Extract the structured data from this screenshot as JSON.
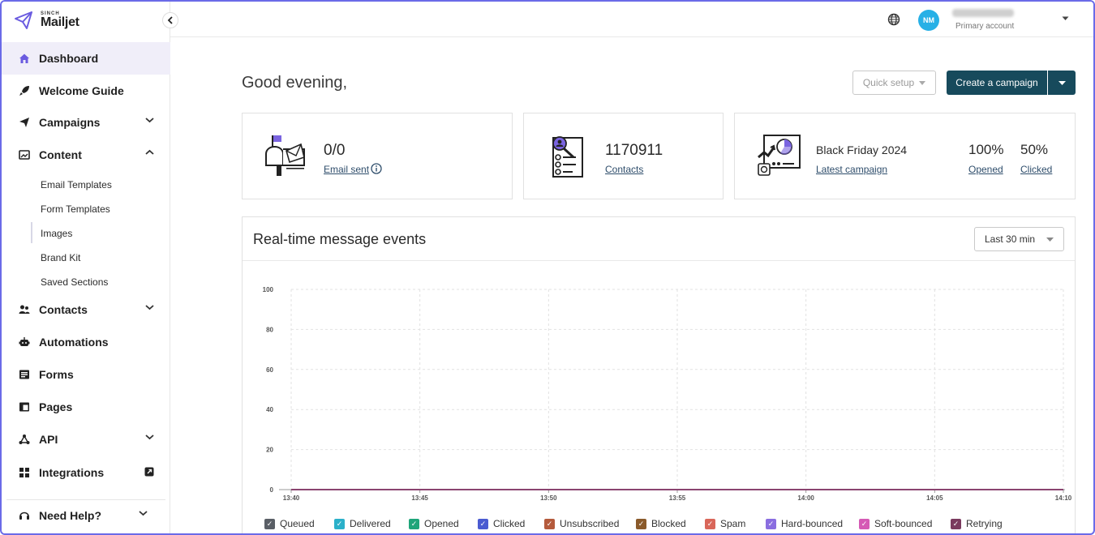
{
  "app": {
    "brand_small": "SINCH",
    "brand_name": "Mailjet"
  },
  "sidebar": {
    "items": [
      {
        "label": "Dashboard",
        "icon": "home-icon",
        "active": true
      },
      {
        "label": "Welcome Guide",
        "icon": "rocket-icon"
      },
      {
        "label": "Campaigns",
        "icon": "paper-plane-icon",
        "expandable": "down"
      },
      {
        "label": "Content",
        "icon": "image-icon",
        "expandable": "up"
      },
      {
        "label": "Contacts",
        "icon": "people-icon",
        "expandable": "down"
      },
      {
        "label": "Automations",
        "icon": "robot-icon"
      },
      {
        "label": "Forms",
        "icon": "form-icon"
      },
      {
        "label": "Pages",
        "icon": "page-icon"
      },
      {
        "label": "API",
        "icon": "api-icon",
        "expandable": "down"
      },
      {
        "label": "Integrations",
        "icon": "grid-icon",
        "external": true
      },
      {
        "label": "Need Help?",
        "icon": "headset-icon",
        "expandable": "down"
      }
    ],
    "content_subitems": [
      "Email Templates",
      "Form Templates",
      "Images",
      "Brand Kit",
      "Saved Sections"
    ]
  },
  "topbar": {
    "avatar_initials": "NM",
    "account_subtitle": "Primary account"
  },
  "main": {
    "greeting": "Good evening,",
    "quick_setup_label": "Quick setup",
    "create_campaign_label": "Create a campaign",
    "cards": {
      "email": {
        "value": "0/0",
        "link": "Email sent"
      },
      "contacts": {
        "value": "1170911",
        "link": "Contacts"
      },
      "campaign": {
        "name": "Black Friday 2024",
        "link": "Latest campaign",
        "opened_value": "100%",
        "opened_label": "Opened",
        "clicked_value": "50%",
        "clicked_label": "Clicked"
      }
    },
    "events_panel": {
      "title": "Real-time message events",
      "range_label": "Last 30 min"
    }
  },
  "chart_data": {
    "type": "line",
    "title": "",
    "xlabel": "",
    "ylabel": "",
    "x": [
      "13:40",
      "13:45",
      "13:50",
      "13:55",
      "14:00",
      "14:05",
      "14:10"
    ],
    "yticks": [
      0,
      20,
      40,
      60,
      80,
      100
    ],
    "ylim": [
      0,
      100
    ],
    "grid": true,
    "legend_position": "bottom",
    "series": [
      {
        "name": "Queued",
        "color": "#5a5f66",
        "values": [
          0,
          0,
          0,
          0,
          0,
          0,
          0
        ]
      },
      {
        "name": "Delivered",
        "color": "#2bb0c9",
        "values": [
          0,
          0,
          0,
          0,
          0,
          0,
          0
        ]
      },
      {
        "name": "Opened",
        "color": "#1fa57a",
        "values": [
          0,
          0,
          0,
          0,
          0,
          0,
          0
        ]
      },
      {
        "name": "Clicked",
        "color": "#4a5bd1",
        "values": [
          0,
          0,
          0,
          0,
          0,
          0,
          0
        ]
      },
      {
        "name": "Unsubscribed",
        "color": "#b45a3c",
        "values": [
          0,
          0,
          0,
          0,
          0,
          0,
          0
        ]
      },
      {
        "name": "Blocked",
        "color": "#8a5a2b",
        "values": [
          0,
          0,
          0,
          0,
          0,
          0,
          0
        ]
      },
      {
        "name": "Spam",
        "color": "#d9675a",
        "values": [
          0,
          0,
          0,
          0,
          0,
          0,
          0
        ]
      },
      {
        "name": "Hard-bounced",
        "color": "#8a6ee0",
        "values": [
          0,
          0,
          0,
          0,
          0,
          0,
          0
        ]
      },
      {
        "name": "Soft-bounced",
        "color": "#d55ab5",
        "values": [
          0,
          0,
          0,
          0,
          0,
          0,
          0
        ]
      },
      {
        "name": "Retrying",
        "color": "#7a3a5e",
        "values": [
          0,
          0,
          0,
          0,
          0,
          0,
          0
        ]
      }
    ]
  }
}
